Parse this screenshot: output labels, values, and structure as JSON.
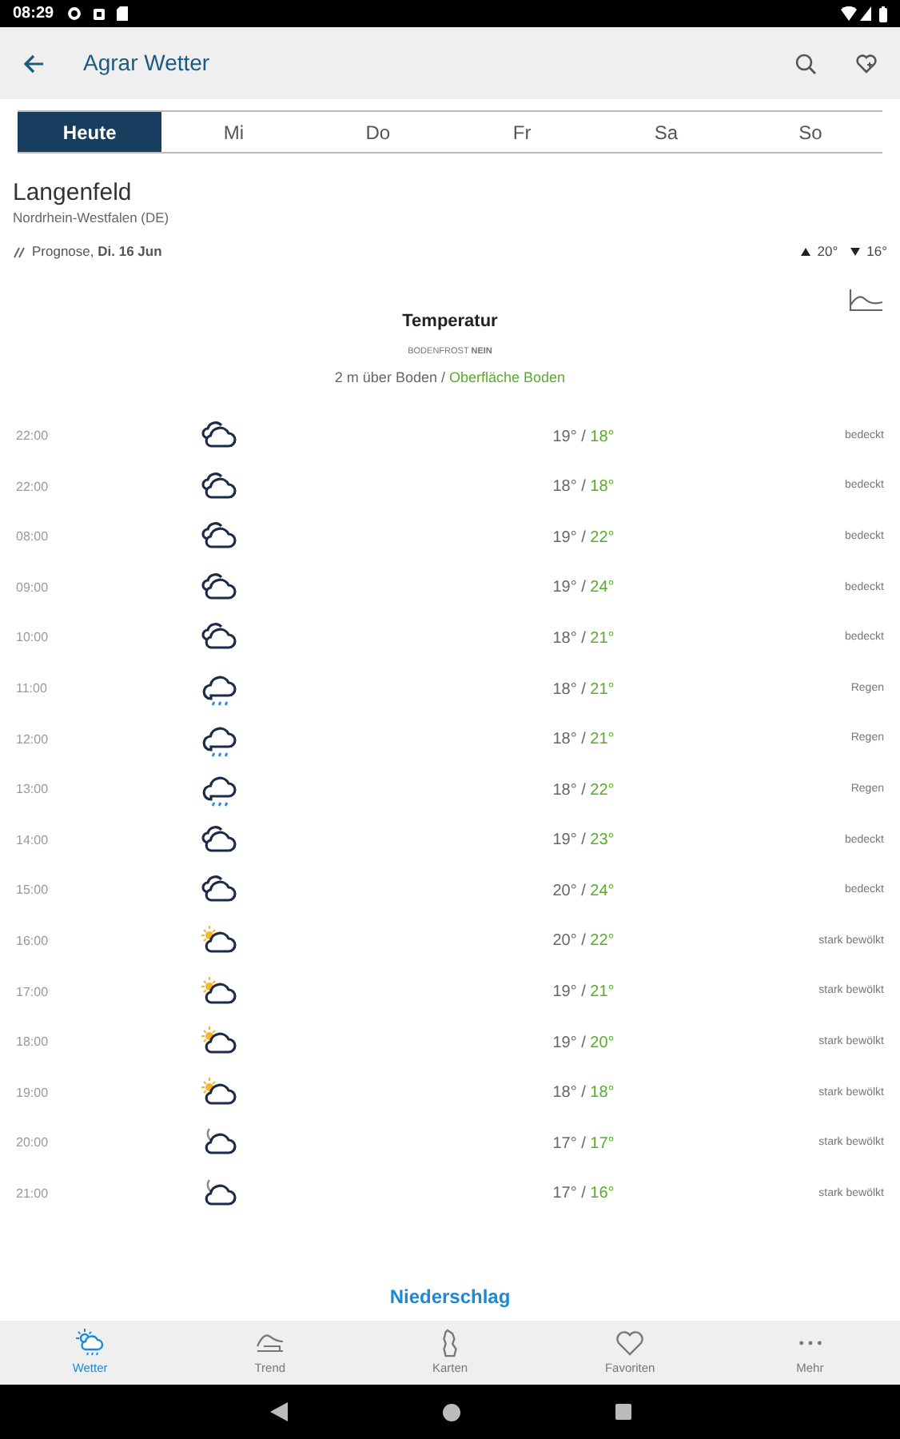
{
  "status_bar": {
    "time": "08:29"
  },
  "app_bar": {
    "title": "Agrar Wetter"
  },
  "tabs": [
    {
      "label": "Heute",
      "selected": true
    },
    {
      "label": "Mi",
      "selected": false
    },
    {
      "label": "Do",
      "selected": false
    },
    {
      "label": "Fr",
      "selected": false
    },
    {
      "label": "Sa",
      "selected": false
    },
    {
      "label": "So",
      "selected": false
    }
  ],
  "location": {
    "name": "Langenfeld",
    "region": "Nordrhein-Westfalen (DE)",
    "forecast": "Prognose, **Di. 16 Jun**",
    "high": "20°",
    "low": "16°"
  },
  "temperature": {
    "title": "Temperatur",
    "ground_frost": "BODENFROST **NEIN**",
    "air_label": "2 m über Boden",
    "separator": "/",
    "ground_label": "Oberfläche Boden"
  },
  "rows": [
    {
      "time": "22:00",
      "kind": "cloudy",
      "air": "19°",
      "separator": "/",
      "ground": "18°",
      "condition": "bedeckt"
    },
    {
      "time": "22:00",
      "kind": "cloudy",
      "air": "18°",
      "separator": "/",
      "ground": "18°",
      "condition": "bedeckt"
    },
    {
      "time": "08:00",
      "kind": "cloudy",
      "air": "19°",
      "separator": "/",
      "ground": "22°",
      "condition": "bedeckt"
    },
    {
      "time": "09:00",
      "kind": "cloudy",
      "air": "19°",
      "separator": "/",
      "ground": "24°",
      "condition": "bedeckt"
    },
    {
      "time": "10:00",
      "kind": "cloudy",
      "air": "18°",
      "separator": "/",
      "ground": "21°",
      "condition": "bedeckt"
    },
    {
      "time": "11:00",
      "kind": "rain",
      "air": "18°",
      "separator": "/",
      "ground": "21°",
      "condition": "Regen"
    },
    {
      "time": "12:00",
      "kind": "rain",
      "air": "18°",
      "separator": "/",
      "ground": "21°",
      "condition": "Regen"
    },
    {
      "time": "13:00",
      "kind": "rain",
      "air": "18°",
      "separator": "/",
      "ground": "22°",
      "condition": "Regen"
    },
    {
      "time": "14:00",
      "kind": "cloudy",
      "air": "19°",
      "separator": "/",
      "ground": "23°",
      "condition": "bedeckt"
    },
    {
      "time": "15:00",
      "kind": "cloudy",
      "air": "20°",
      "separator": "/",
      "ground": "24°",
      "condition": "bedeckt"
    },
    {
      "time": "16:00",
      "kind": "sun-cloud",
      "air": "20°",
      "separator": "/",
      "ground": "22°",
      "condition": "stark bewölkt"
    },
    {
      "time": "17:00",
      "kind": "sun-cloud",
      "air": "19°",
      "separator": "/",
      "ground": "21°",
      "condition": "stark bewölkt"
    },
    {
      "time": "18:00",
      "kind": "sun-cloud",
      "air": "19°",
      "separator": "/",
      "ground": "20°",
      "condition": "stark bewölkt"
    },
    {
      "time": "19:00",
      "kind": "sun-cloud",
      "air": "18°",
      "separator": "/",
      "ground": "18°",
      "condition": "stark bewölkt"
    },
    {
      "time": "20:00",
      "kind": "moon-cloud",
      "air": "17°",
      "separator": "/",
      "ground": "17°",
      "condition": "stark bewölkt"
    },
    {
      "time": "21:00",
      "kind": "moon-cloud",
      "air": "17°",
      "separator": "/",
      "ground": "16°",
      "condition": "stark bewölkt"
    }
  ],
  "sections": [
    {
      "title": "Niederschlag",
      "kind": "link"
    }
  ],
  "bottom_nav": [
    {
      "label": "Wetter",
      "kind": "weather",
      "selected": true
    },
    {
      "label": "Trend",
      "kind": "trend",
      "selected": false
    },
    {
      "label": "Karten",
      "kind": "map",
      "selected": false
    },
    {
      "label": "Favoriten",
      "kind": "heart",
      "selected": false
    },
    {
      "label": "Mehr",
      "kind": "more",
      "selected": false
    }
  ]
}
